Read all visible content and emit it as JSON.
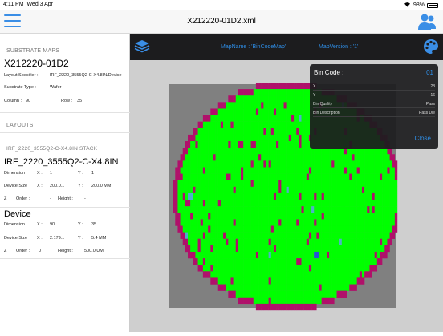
{
  "status_bar": {
    "time": "4:11 PM",
    "date": "Wed 3 Apr",
    "battery": "98%"
  },
  "nav": {
    "title": "X212220-01D2.xml"
  },
  "sidebar": {
    "substrate_header": "SUBSTRATE MAPS",
    "substrate_id": "X212220-01D2",
    "layout_specifier_label": "Layout Specifier :",
    "layout_specifier_value": "IRF_2220_3555Q2-C-X4.8IN/Device",
    "substrate_type_label": "Substrate Type :",
    "substrate_type_value": "Wafer",
    "column_label": "Column :",
    "column_value": "90",
    "row_label": "Row :",
    "row_value": "35",
    "layouts_header": "LAYOUTS",
    "stack_name": "IRF_2220_3555Q2-C-X4.8IN STACK",
    "layout_name": "IRF_2220_3555Q2-C-X4.8IN",
    "layout_dimension_label": "Dimension",
    "layout_dim_x_label": "X :",
    "layout_dim_x_value": "1",
    "layout_dim_y_label": "Y :",
    "layout_dim_y_value": "1",
    "layout_size_label": "Device Size",
    "layout_size_x_value": "200.0...",
    "layout_size_y_value": "200.0 MM",
    "layout_z_label": "Z",
    "layout_order_label": "Order :",
    "layout_order_value": "-",
    "layout_height_label": "Height :",
    "layout_height_value": "-",
    "device_name": "Device",
    "device_dimension_label": "Dimension",
    "device_dim_x_label": "X :",
    "device_dim_x_value": "90",
    "device_dim_y_label": "Y :",
    "device_dim_y_value": "35",
    "device_size_label": "Device Size",
    "device_size_x_value": "2.179...",
    "device_size_y_value": "5.4 MM",
    "device_z_label": "Z",
    "device_order_label": "Order :",
    "device_order_value": "0",
    "device_height_label": "Height :",
    "device_height_value": "500.0 UM"
  },
  "toolbar": {
    "map_name": "MapName : 'BinCodeMap'",
    "map_version": "MapVersion : '1'"
  },
  "bin_popover": {
    "title": "Bin Code :",
    "code": "01",
    "rows": [
      {
        "label": "X",
        "value": "28"
      },
      {
        "label": "Y",
        "value": "16"
      },
      {
        "label": "Bin Quality",
        "value": "Pass"
      },
      {
        "label": "Bin Description",
        "value": "Pass Die"
      }
    ],
    "close_label": "Close"
  },
  "colors": {
    "pass": "#00ff00",
    "fail": "#b0106a",
    "other_blue": "#2a52d8",
    "other_cyan": "#4fb0c8",
    "wafer_bg": "#808080",
    "accent": "#2f8fe8"
  }
}
